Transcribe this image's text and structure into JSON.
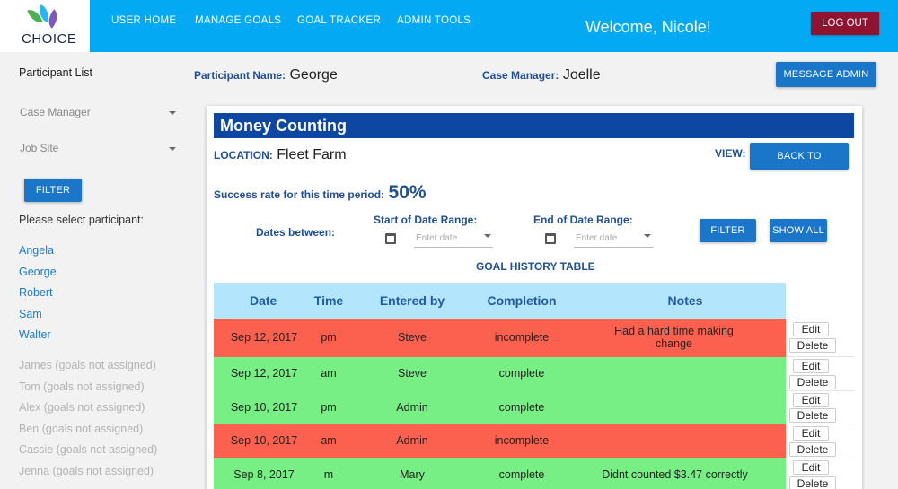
{
  "brand": {
    "name": "CHOICE"
  },
  "nav": {
    "items": [
      "USER HOME",
      "MANAGE GOALS",
      "GOAL TRACKER",
      "ADMIN TOOLS"
    ],
    "welcome": "Welcome, Nicole!",
    "logout_label": "LOG OUT"
  },
  "sidebar": {
    "title": "Participant List",
    "case_manager_placeholder": "Case Manager",
    "job_site_placeholder": "Job Site",
    "filter_label": "FILTER",
    "prompt": "Please select participant:",
    "participants": [
      "Angela",
      "George",
      "Robert",
      "Sam",
      "Walter"
    ],
    "unassigned": [
      "James (goals not assigned)",
      "Tom (goals not assigned)",
      "Alex (goals not assigned)",
      "Ben (goals not assigned)",
      "Cassie (goals not assigned)",
      "Jenna (goals not assigned)"
    ]
  },
  "header": {
    "participant_label": "Participant Name:",
    "participant_value": "George",
    "case_manager_label": "Case Manager:",
    "case_manager_value": "Joelle",
    "message_admin_label": "MESSAGE ADMIN"
  },
  "goal": {
    "title": "Money Counting",
    "location_label": "LOCATION:",
    "location_value": "Fleet Farm",
    "view_label": "VIEW:",
    "back_label": "BACK TO TRACKING",
    "success_label": "Success rate for this time period:",
    "success_value": "50%",
    "dates_between_label": "Dates between:",
    "start_label": "Start of Date Range:",
    "end_label": "End of Date Range:",
    "date_placeholder": "Enter date",
    "filter_label": "FILTER",
    "show_all_label": "SHOW ALL",
    "table_title": "GOAL HISTORY TABLE"
  },
  "table": {
    "columns": [
      "Date",
      "Time",
      "Entered by",
      "Completion",
      "Notes"
    ],
    "edit_label": "Edit",
    "delete_label": "Delete",
    "rows": [
      {
        "date": "Sep 12, 2017",
        "time": "pm",
        "entered_by": "Steve",
        "completion": "incomplete",
        "notes": "Had a hard time making change"
      },
      {
        "date": "Sep 12, 2017",
        "time": "am",
        "entered_by": "Steve",
        "completion": "complete",
        "notes": ""
      },
      {
        "date": "Sep 10, 2017",
        "time": "pm",
        "entered_by": "Admin",
        "completion": "complete",
        "notes": ""
      },
      {
        "date": "Sep 10, 2017",
        "time": "am",
        "entered_by": "Admin",
        "completion": "incomplete",
        "notes": ""
      },
      {
        "date": "Sep 8, 2017",
        "time": "m",
        "entered_by": "Mary",
        "completion": "complete",
        "notes": "Didnt counted $3.47 correctly"
      }
    ]
  },
  "colors": {
    "nav": "#04a9f4",
    "incomplete": "#fc6150",
    "complete": "#77ef85",
    "title_bar": "#0d47a1"
  }
}
